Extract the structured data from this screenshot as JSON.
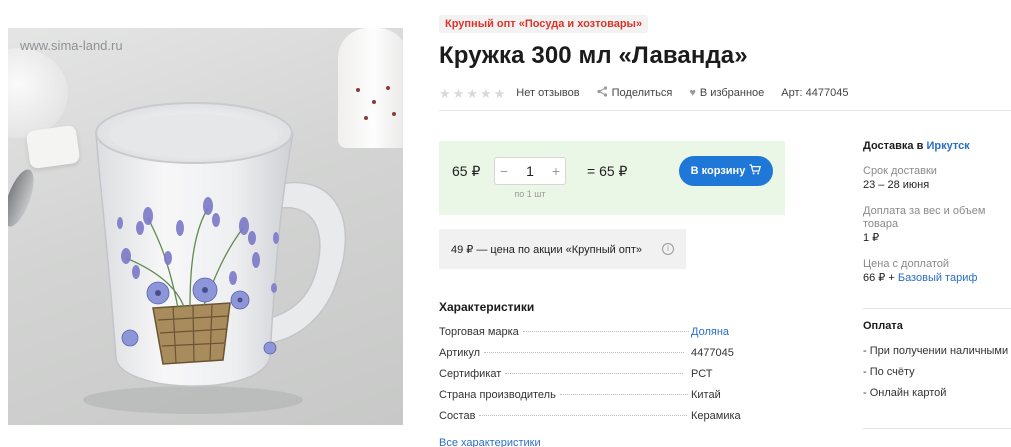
{
  "photo": {
    "watermark": "www.sima-land.ru",
    "alt": "Кружка 300 мл «Лаванда»"
  },
  "product": {
    "tag": "Крупный опт «Посуда и хозтовары»",
    "title": "Кружка 300 мл «Лаванда»",
    "rating_stars": 0,
    "reviews": "Нет отзывов",
    "share": "Поделиться",
    "favorite": "В избранное",
    "article": "Арт: 4477045"
  },
  "buy": {
    "price": "65 ₽",
    "qty_minus": "−",
    "qty_value": "1",
    "qty_plus": "+",
    "qty_note": "по 1 шт",
    "total": "= 65 ₽",
    "cart_button": "В корзину"
  },
  "promo": {
    "text": "49 ₽ — цена по акции «Крупный опт»",
    "info_icon": "i"
  },
  "characteristics": {
    "title": "Характеристики",
    "rows": [
      {
        "key": "Торговая марка",
        "value": "Доляна",
        "link": true
      },
      {
        "key": "Артикул",
        "value": "4477045",
        "link": false
      },
      {
        "key": "Сертификат",
        "value": "РСТ",
        "link": false
      },
      {
        "key": "Страна производитель",
        "value": "Китай",
        "link": false
      },
      {
        "key": "Состав",
        "value": "Керамика",
        "link": false
      }
    ],
    "all_link": "Все характеристики"
  },
  "delivery": {
    "heading": "Доставка в",
    "city": "Иркутск",
    "term_label": "Срок доставки",
    "term_value": "23 – 28 июня",
    "surcharge_label": "Доплата за вес и объем товара",
    "surcharge_value": "1 ₽",
    "price_label": "Цена с доплатой",
    "price_value": "66 ₽ +",
    "tariff_link": "Базовый тариф"
  },
  "payment": {
    "heading": "Оплата",
    "items": [
      "- При получении наличными",
      "- По счёту",
      "- Онлайн картой"
    ]
  },
  "colors": {
    "accent": "#1f78d8",
    "tag_red": "#d9352a",
    "buybox_bg": "#eaf6e6",
    "link": "#2a6ec3"
  }
}
